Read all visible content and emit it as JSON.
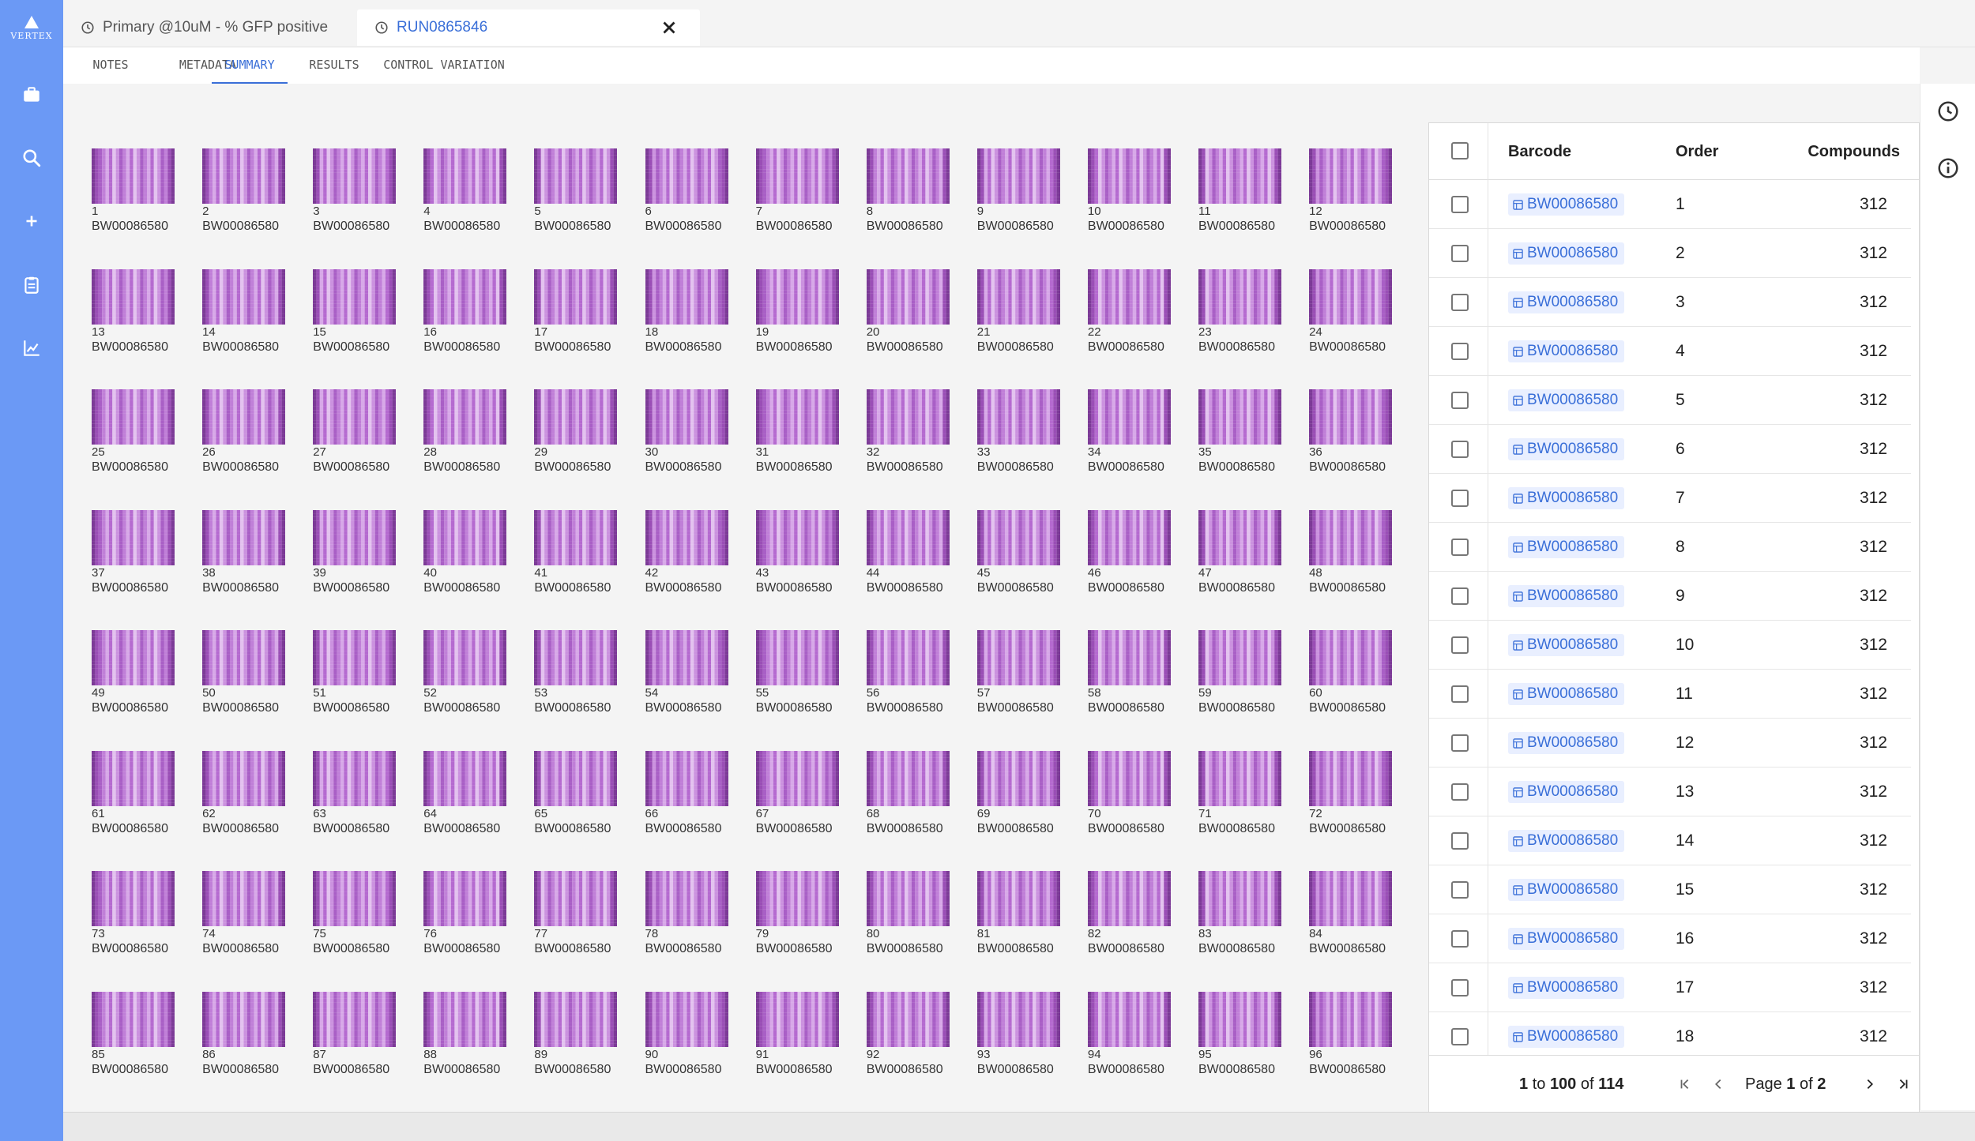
{
  "app": {
    "logo_text": "VERTEX",
    "accent": "#6b99f5",
    "link_color": "#3a6fd8"
  },
  "sidebar": {
    "items": [
      {
        "name": "briefcase-icon"
      },
      {
        "name": "search-icon"
      },
      {
        "name": "plus-icon"
      },
      {
        "name": "clipboard-icon"
      },
      {
        "name": "chart-icon"
      }
    ]
  },
  "doc_tabs": [
    {
      "label": "Primary @10uM - % GFP positive",
      "icon": "clock-icon"
    },
    {
      "label": "RUN0865846",
      "icon": "clock-icon",
      "active": true
    }
  ],
  "subtabs": [
    {
      "label": "NOTES"
    },
    {
      "label": "METADATA"
    },
    {
      "label": "SUMMARY",
      "active": true
    },
    {
      "label": "RESULTS"
    },
    {
      "label": "CONTROL VARIATION"
    }
  ],
  "right_rail": [
    {
      "name": "history-icon"
    },
    {
      "name": "info-icon"
    }
  ],
  "plates": {
    "barcode": "BW00086580",
    "count": 96,
    "items": [
      {
        "num": "1",
        "barcode": "BW00086580"
      },
      {
        "num": "2",
        "barcode": "BW00086580"
      },
      {
        "num": "3",
        "barcode": "BW00086580"
      },
      {
        "num": "4",
        "barcode": "BW00086580"
      },
      {
        "num": "5",
        "barcode": "BW00086580"
      },
      {
        "num": "6",
        "barcode": "BW00086580"
      },
      {
        "num": "7",
        "barcode": "BW00086580"
      },
      {
        "num": "8",
        "barcode": "BW00086580"
      },
      {
        "num": "9",
        "barcode": "BW00086580"
      },
      {
        "num": "10",
        "barcode": "BW00086580"
      },
      {
        "num": "11",
        "barcode": "BW00086580"
      },
      {
        "num": "12",
        "barcode": "BW00086580"
      },
      {
        "num": "13",
        "barcode": "BW00086580"
      },
      {
        "num": "14",
        "barcode": "BW00086580"
      },
      {
        "num": "15",
        "barcode": "BW00086580"
      },
      {
        "num": "16",
        "barcode": "BW00086580"
      },
      {
        "num": "17",
        "barcode": "BW00086580"
      },
      {
        "num": "18",
        "barcode": "BW00086580"
      },
      {
        "num": "19",
        "barcode": "BW00086580"
      },
      {
        "num": "20",
        "barcode": "BW00086580"
      },
      {
        "num": "21",
        "barcode": "BW00086580"
      },
      {
        "num": "22",
        "barcode": "BW00086580"
      },
      {
        "num": "23",
        "barcode": "BW00086580"
      },
      {
        "num": "24",
        "barcode": "BW00086580"
      },
      {
        "num": "25",
        "barcode": "BW00086580"
      },
      {
        "num": "26",
        "barcode": "BW00086580"
      },
      {
        "num": "27",
        "barcode": "BW00086580"
      },
      {
        "num": "28",
        "barcode": "BW00086580"
      },
      {
        "num": "29",
        "barcode": "BW00086580"
      },
      {
        "num": "30",
        "barcode": "BW00086580"
      },
      {
        "num": "31",
        "barcode": "BW00086580"
      },
      {
        "num": "32",
        "barcode": "BW00086580"
      },
      {
        "num": "33",
        "barcode": "BW00086580"
      },
      {
        "num": "34",
        "barcode": "BW00086580"
      },
      {
        "num": "35",
        "barcode": "BW00086580"
      },
      {
        "num": "36",
        "barcode": "BW00086580"
      },
      {
        "num": "37",
        "barcode": "BW00086580"
      },
      {
        "num": "38",
        "barcode": "BW00086580"
      },
      {
        "num": "39",
        "barcode": "BW00086580"
      },
      {
        "num": "40",
        "barcode": "BW00086580"
      },
      {
        "num": "41",
        "barcode": "BW00086580"
      },
      {
        "num": "42",
        "barcode": "BW00086580"
      },
      {
        "num": "43",
        "barcode": "BW00086580"
      },
      {
        "num": "44",
        "barcode": "BW00086580"
      },
      {
        "num": "45",
        "barcode": "BW00086580"
      },
      {
        "num": "46",
        "barcode": "BW00086580"
      },
      {
        "num": "47",
        "barcode": "BW00086580"
      },
      {
        "num": "48",
        "barcode": "BW00086580"
      },
      {
        "num": "49",
        "barcode": "BW00086580"
      },
      {
        "num": "50",
        "barcode": "BW00086580"
      },
      {
        "num": "51",
        "barcode": "BW00086580"
      },
      {
        "num": "52",
        "barcode": "BW00086580"
      },
      {
        "num": "53",
        "barcode": "BW00086580"
      },
      {
        "num": "54",
        "barcode": "BW00086580"
      },
      {
        "num": "55",
        "barcode": "BW00086580"
      },
      {
        "num": "56",
        "barcode": "BW00086580"
      },
      {
        "num": "57",
        "barcode": "BW00086580"
      },
      {
        "num": "58",
        "barcode": "BW00086580"
      },
      {
        "num": "59",
        "barcode": "BW00086580"
      },
      {
        "num": "60",
        "barcode": "BW00086580"
      },
      {
        "num": "61",
        "barcode": "BW00086580"
      },
      {
        "num": "62",
        "barcode": "BW00086580"
      },
      {
        "num": "63",
        "barcode": "BW00086580"
      },
      {
        "num": "64",
        "barcode": "BW00086580"
      },
      {
        "num": "65",
        "barcode": "BW00086580"
      },
      {
        "num": "66",
        "barcode": "BW00086580"
      },
      {
        "num": "67",
        "barcode": "BW00086580"
      },
      {
        "num": "68",
        "barcode": "BW00086580"
      },
      {
        "num": "69",
        "barcode": "BW00086580"
      },
      {
        "num": "70",
        "barcode": "BW00086580"
      },
      {
        "num": "71",
        "barcode": "BW00086580"
      },
      {
        "num": "72",
        "barcode": "BW00086580"
      },
      {
        "num": "73",
        "barcode": "BW00086580"
      },
      {
        "num": "74",
        "barcode": "BW00086580"
      },
      {
        "num": "75",
        "barcode": "BW00086580"
      },
      {
        "num": "76",
        "barcode": "BW00086580"
      },
      {
        "num": "77",
        "barcode": "BW00086580"
      },
      {
        "num": "78",
        "barcode": "BW00086580"
      },
      {
        "num": "79",
        "barcode": "BW00086580"
      },
      {
        "num": "80",
        "barcode": "BW00086580"
      },
      {
        "num": "81",
        "barcode": "BW00086580"
      },
      {
        "num": "82",
        "barcode": "BW00086580"
      },
      {
        "num": "83",
        "barcode": "BW00086580"
      },
      {
        "num": "84",
        "barcode": "BW00086580"
      },
      {
        "num": "85",
        "barcode": "BW00086580"
      },
      {
        "num": "86",
        "barcode": "BW00086580"
      },
      {
        "num": "87",
        "barcode": "BW00086580"
      },
      {
        "num": "88",
        "barcode": "BW00086580"
      },
      {
        "num": "89",
        "barcode": "BW00086580"
      },
      {
        "num": "90",
        "barcode": "BW00086580"
      },
      {
        "num": "91",
        "barcode": "BW00086580"
      },
      {
        "num": "92",
        "barcode": "BW00086580"
      },
      {
        "num": "93",
        "barcode": "BW00086580"
      },
      {
        "num": "94",
        "barcode": "BW00086580"
      },
      {
        "num": "95",
        "barcode": "BW00086580"
      },
      {
        "num": "96",
        "barcode": "BW00086580"
      }
    ]
  },
  "table": {
    "columns": {
      "barcode": "Barcode",
      "order": "Order",
      "compounds": "Compounds"
    },
    "rows": [
      {
        "barcode": "BW00086580",
        "order": "1",
        "compounds": "312"
      },
      {
        "barcode": "BW00086580",
        "order": "2",
        "compounds": "312"
      },
      {
        "barcode": "BW00086580",
        "order": "3",
        "compounds": "312"
      },
      {
        "barcode": "BW00086580",
        "order": "4",
        "compounds": "312"
      },
      {
        "barcode": "BW00086580",
        "order": "5",
        "compounds": "312"
      },
      {
        "barcode": "BW00086580",
        "order": "6",
        "compounds": "312"
      },
      {
        "barcode": "BW00086580",
        "order": "7",
        "compounds": "312"
      },
      {
        "barcode": "BW00086580",
        "order": "8",
        "compounds": "312"
      },
      {
        "barcode": "BW00086580",
        "order": "9",
        "compounds": "312"
      },
      {
        "barcode": "BW00086580",
        "order": "10",
        "compounds": "312"
      },
      {
        "barcode": "BW00086580",
        "order": "11",
        "compounds": "312"
      },
      {
        "barcode": "BW00086580",
        "order": "12",
        "compounds": "312"
      },
      {
        "barcode": "BW00086580",
        "order": "13",
        "compounds": "312"
      },
      {
        "barcode": "BW00086580",
        "order": "14",
        "compounds": "312"
      },
      {
        "barcode": "BW00086580",
        "order": "15",
        "compounds": "312"
      },
      {
        "barcode": "BW00086580",
        "order": "16",
        "compounds": "312"
      },
      {
        "barcode": "BW00086580",
        "order": "17",
        "compounds": "312"
      },
      {
        "barcode": "BW00086580",
        "order": "18",
        "compounds": "312"
      }
    ],
    "pagination": {
      "from": "1",
      "to_word": "to",
      "to": "100",
      "of_word": "of",
      "total": "114",
      "page_word": "Page",
      "page": "1",
      "page_of_word": "of",
      "pages": "2"
    }
  }
}
